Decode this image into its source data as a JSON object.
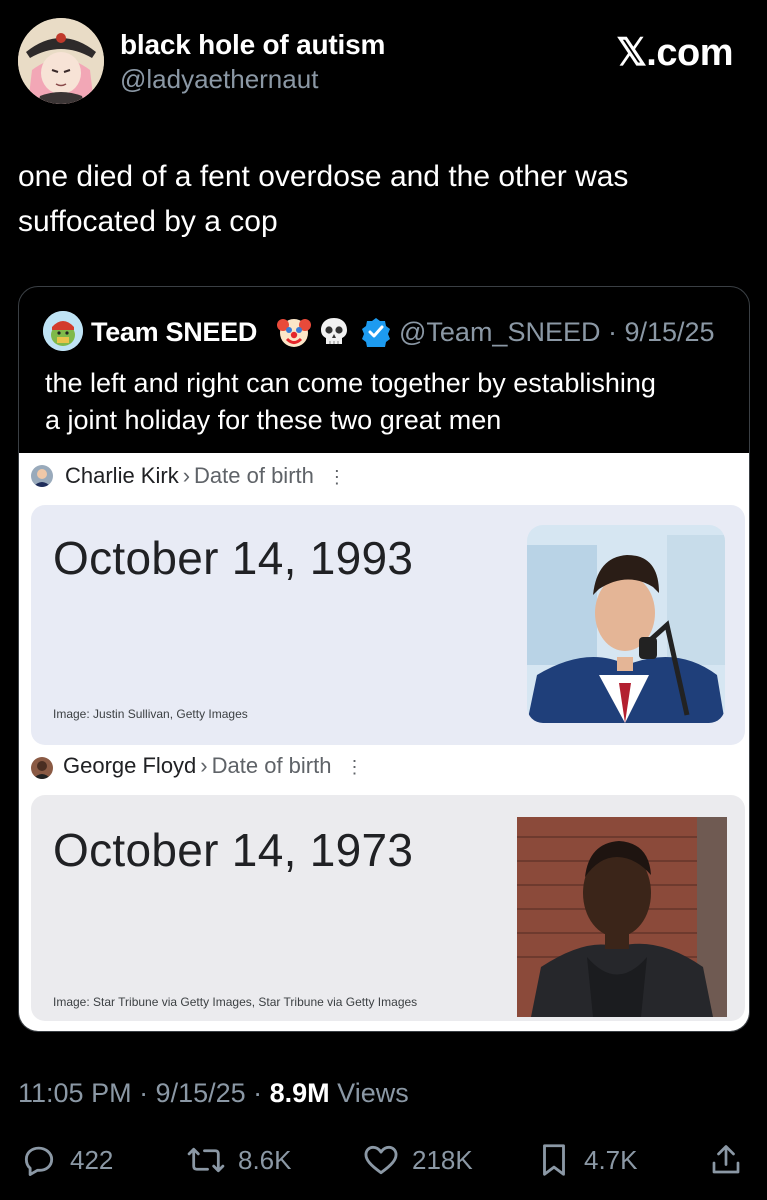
{
  "author": {
    "display_name": "black hole of autism",
    "handle": "@ladyaethernaut"
  },
  "site_label": "𝕏.com",
  "tweet": {
    "text_line1": "one died of a fent overdose and the other was",
    "text_line2": "suffocated by a cop"
  },
  "quoted": {
    "display_name": "Team SNEED",
    "emojis": [
      "clown-face",
      "skull"
    ],
    "verified": true,
    "handle_date": "@Team_SNEED · 9/15/25",
    "text_line1": "the left and right can come together by establishing",
    "text_line2": "a joint holiday for these two great men",
    "image": {
      "result1": {
        "name": "Charlie Kirk",
        "attribute": "Date of birth",
        "date": "October 14, 1993",
        "credit": "Image: Justin Sullivan, Getty Images"
      },
      "result2": {
        "name": "George Floyd",
        "attribute": "Date of birth",
        "date": "October 14, 1973",
        "credit": "Image: Star Tribune via Getty Images, Star Tribune via Getty Images"
      }
    }
  },
  "meta": {
    "time_date": "11:05 PM · 9/15/25 · ",
    "views_count": "8.9M",
    "views_label": " Views"
  },
  "actions": {
    "replies": "422",
    "reposts": "8.6K",
    "likes": "218K",
    "bookmarks": "4.7K"
  },
  "colors": {
    "background": "#000000",
    "secondary_text": "#8b98a5",
    "verified_blue": "#1d9bf0",
    "card_border": "#3a3f44"
  }
}
